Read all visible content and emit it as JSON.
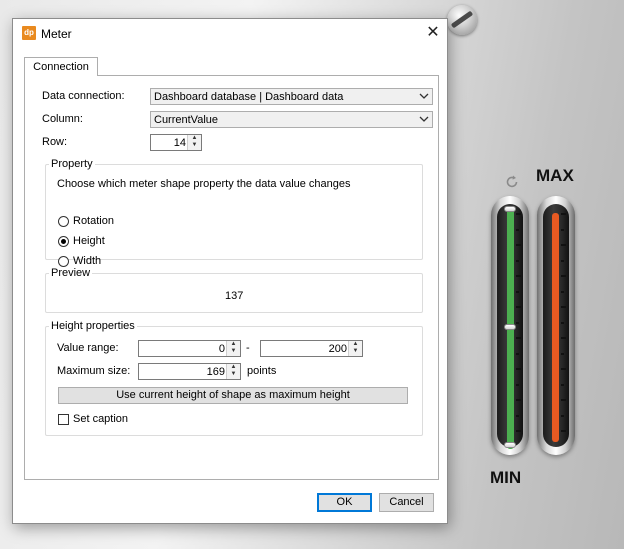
{
  "window": {
    "title": "Meter",
    "icon_text": "dp",
    "close_glyph": "✕"
  },
  "tabs": [
    {
      "label": "Connection",
      "active": true
    }
  ],
  "connection": {
    "data_connection_label": "Data connection:",
    "data_connection_value": "Dashboard database | Dashboard data",
    "column_label": "Column:",
    "column_value": "CurrentValue",
    "row_label": "Row:",
    "row_value": "14"
  },
  "property": {
    "group_title": "Property",
    "description": "Choose which meter shape property the data value changes",
    "options": [
      {
        "label": "Rotation",
        "selected": false
      },
      {
        "label": "Height",
        "selected": true
      },
      {
        "label": "Width",
        "selected": false
      }
    ]
  },
  "preview": {
    "group_title": "Preview",
    "value": "137"
  },
  "height_properties": {
    "group_title": "Height properties",
    "value_range_label": "Value range:",
    "range_min": "0",
    "range_separator": "-",
    "range_max": "200",
    "max_size_label": "Maximum size:",
    "max_size_value": "169",
    "max_size_unit": "points",
    "use_current_button": "Use current height of shape as maximum height",
    "set_caption_label": "Set caption",
    "set_caption_checked": false
  },
  "footer": {
    "ok_label": "OK",
    "cancel_label": "Cancel"
  },
  "meters": {
    "max_label": "MAX",
    "min_label": "MIN",
    "green_fill_color": "#4caf50",
    "red_fill_color": "#e85a22",
    "rotate_icon": "rotate-handle-icon"
  }
}
